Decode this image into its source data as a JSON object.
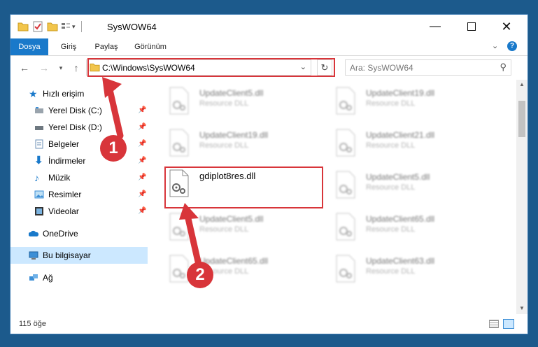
{
  "window": {
    "title": "SysWOW64"
  },
  "ribbon": {
    "tabs": [
      "Dosya",
      "Giriş",
      "Paylaş",
      "Görünüm"
    ]
  },
  "address": {
    "path": "C:\\Windows\\SysWOW64"
  },
  "search": {
    "placeholder": "Ara: SysWOW64"
  },
  "sidebar": {
    "quick_access": "Hızlı erişim",
    "items": [
      {
        "label": "Yerel Disk (C:)"
      },
      {
        "label": "Yerel Disk (D:)"
      },
      {
        "label": "Belgeler"
      },
      {
        "label": "İndirmeler"
      },
      {
        "label": "Müzik"
      },
      {
        "label": "Resimler"
      },
      {
        "label": "Videolar"
      }
    ],
    "onedrive": "OneDrive",
    "this_pc": "Bu bilgisayar",
    "network": "Ağ"
  },
  "files": [
    {
      "name": "UpdateClient5.dll",
      "type": "Resource DLL"
    },
    {
      "name": "UpdateClient19.dll",
      "type": "Resource DLL"
    },
    {
      "name": "UpdateClient19.dll",
      "type": "Resource DLL"
    },
    {
      "name": "UpdateClient21.dll",
      "type": "Resource DLL"
    },
    {
      "name": "gdiplot8res.dll",
      "type": ""
    },
    {
      "name": "UpdateClient5.dll",
      "type": "Resource DLL"
    },
    {
      "name": "UpdateClient5.dll",
      "type": "Resource DLL"
    },
    {
      "name": "UpdateClient65.dll",
      "type": "Resource DLL"
    },
    {
      "name": "UpdateClient65.dll",
      "type": "Resource DLL"
    },
    {
      "name": "UpdateClient63.dll",
      "type": "Resource DLL"
    }
  ],
  "status": {
    "count": "115 öğe"
  },
  "callouts": [
    "1",
    "2"
  ],
  "colors": {
    "accent": "#1979ca",
    "highlight": "#d8353a",
    "selected": "#cce8ff"
  }
}
